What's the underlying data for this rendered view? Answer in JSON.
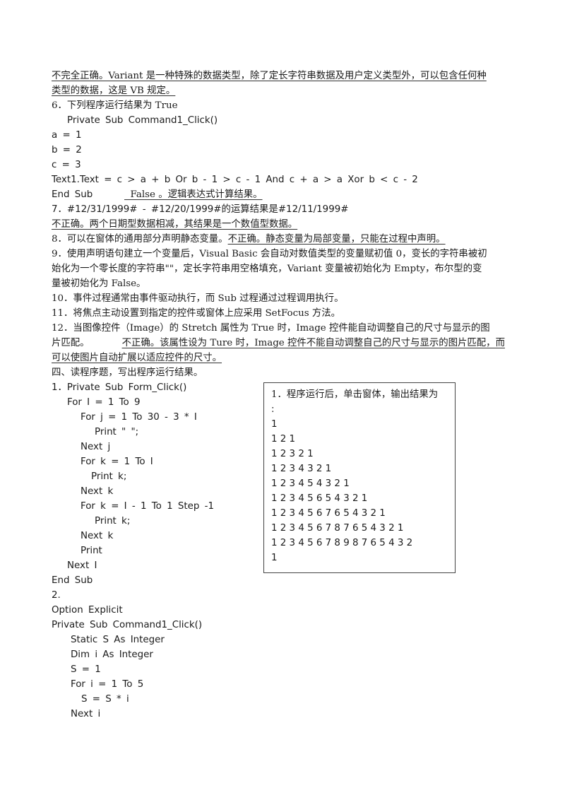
{
  "document": {
    "lines": {
      "l1": "不完全正确。Variant 是一种特殊的数据类型，除了定长字符串数据及用户定义类型外，可以包含任何种",
      "l2": "类型的数据，这是 VB 规定。",
      "q6_title": "6．下列程序运行结果为 True",
      "q6_code": [
        "Private Sub Command1_Click()",
        "a = 1",
        "b = 2",
        "c = 3",
        "Text1.Text = c > a + b Or b - 1 > c - 1 And c + a > a Xor b < c - 2",
        "End Sub"
      ],
      "q6_answer": "  False 。逻辑表达式计算结果。",
      "q7_title": "7．#12/31/1999# - #12/20/1999#的运算结果是#12/11/1999#",
      "q7_answer": "不正确。两个日期型数据相减，其结果是一个数值型数据。",
      "q8_title": "8．可以在窗体的通用部分声明静态变量。",
      "q8_answer": "不正确。静态变量为局部变量，只能在过程中声明。",
      "q9_l1": "9．使用声明语句建立一个变量后，Visual Basic 会自动对数值类型的变量赋初值 0，变长的字符串被初",
      "q9_l2": "始化为一个零长度的字符串\"\"，定长字符串用空格填充，Variant 变量被初始化为 Empty，布尔型的变",
      "q9_l3": "量被初始化为 False。",
      "q10": "10．事件过程通常由事件驱动执行，而 Sub 过程通过过程调用执行。",
      "q11": "11．将焦点主动设置到指定的控件或窗体上应采用 SetFocus 方法。",
      "q12_l1": "12．当图像控件（Image）的 Stretch 属性为 True 时，Image 控件能自动调整自己的尺寸与显示的图",
      "q12_l2_prefix": "片匹配。",
      "q12_l2_answer": "不正确。该属性设为 Ture 时，Image 控件不能自动调整自己的尺寸与显示的图片匹配，而",
      "q12_l3_answer": "可以使图片自动扩展以适应控件的尺寸。",
      "section4": "四、读程序题，写出程序运行结果。"
    },
    "program1": {
      "code": [
        "1．Private Sub Form_Click()",
        "For I = 1 To 9",
        "For j = 1 To 30 - 3 * I",
        "Print \" \";",
        "Next j",
        "For k = 1 To I",
        "Print k;",
        "Next k",
        "For k = I - 1 To 1 Step -1",
        "Print k;",
        "Next k",
        "Print",
        "Next I",
        "End Sub"
      ]
    },
    "program2": {
      "code": [
        "2.",
        "Option Explicit",
        "Private Sub Command1_Click()",
        "Static S As Integer",
        "Dim i As Integer",
        "S = 1",
        "For i = 1 To 5",
        "S = S * i",
        "Next i"
      ]
    },
    "answer_box": {
      "lines": [
        "1．程序运行后，单击窗体，输出结果为",
        ":",
        "1",
        "1 2 1",
        "1 2 3 2 1",
        "1 2 3 4 3 2 1",
        "1 2 3 4 5 4 3 2 1",
        "1 2 3 4 5 6 5 4 3 2 1",
        "1 2 3 4 5 6 7 6 5 4 3 2 1",
        "1 2 3 4 5 6 7 8 7 6 5 4 3 2 1",
        "1 2 3 4 5 6 7 8 9 8 7 6 5 4 3 2",
        "1"
      ]
    }
  }
}
